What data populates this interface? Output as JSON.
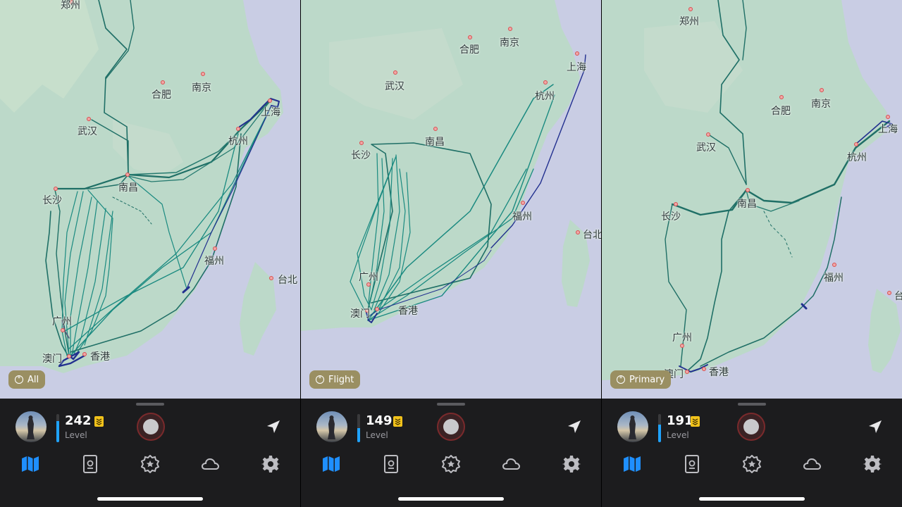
{
  "panels": [
    {
      "filter": "All",
      "level": "242",
      "level_label": "Level",
      "cities": [
        "郑州",
        "合肥",
        "南京",
        "武汉",
        "上海",
        "杭州",
        "南昌",
        "长沙",
        "福州",
        "台北",
        "广州",
        "香港",
        "澳门"
      ]
    },
    {
      "filter": "Flight",
      "level": "149",
      "level_label": "Level",
      "cities": [
        "合肥",
        "南京",
        "武汉",
        "上海",
        "杭州",
        "长沙",
        "南昌",
        "福州",
        "台北",
        "广州",
        "澳门",
        "香港"
      ]
    },
    {
      "filter": "Primary",
      "level": "191",
      "level_label": "Level",
      "cities": [
        "郑州",
        "合肥",
        "南京",
        "武汉",
        "上海",
        "杭州",
        "长沙",
        "南昌",
        "福州",
        "台北",
        "广州",
        "澳门",
        "香港"
      ]
    }
  ],
  "tabs": [
    "map-icon",
    "passport-icon",
    "badge-icon",
    "cloud-icon",
    "gear-icon"
  ],
  "colors": {
    "land": "#bcd9c9",
    "sea": "#c9cde4",
    "track_rail": "#1f6f66",
    "track_flight": "#1a8a80",
    "track_drive": "#22308f",
    "active_tab": "#1f8fff",
    "inactive_tab": "#bdbdc2",
    "level_fill": "#1fa3ff",
    "chip": "#9a8f62"
  }
}
